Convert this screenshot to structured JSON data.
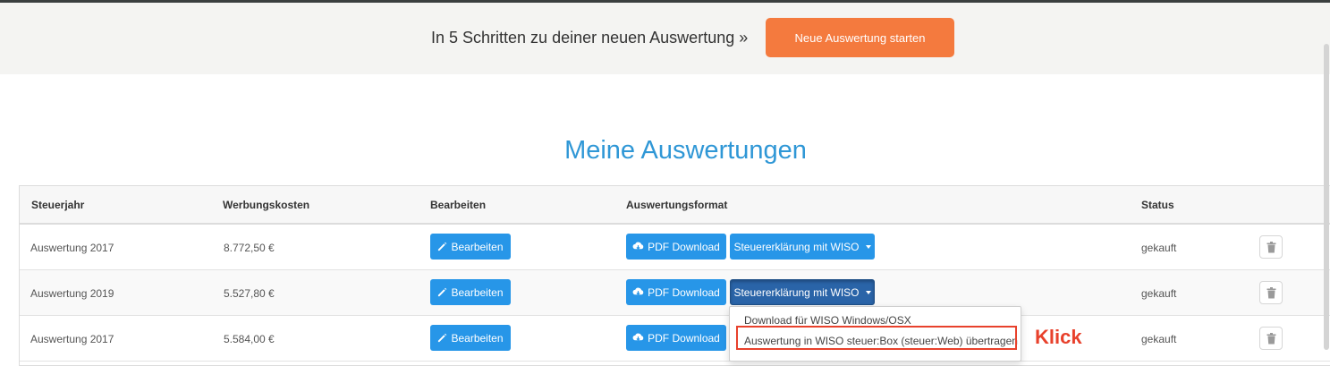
{
  "banner": {
    "text": "In 5 Schritten zu deiner neuen Auswertung »",
    "cta_label": "Neue Auswertung starten"
  },
  "page_title": "Meine Auswertungen",
  "table": {
    "headers": [
      "Steuerjahr",
      "Werbungskosten",
      "Bearbeiten",
      "Auswertungsformat",
      "Status"
    ],
    "rows": [
      {
        "year": "Auswertung 2017",
        "costs": "8.772,50 €",
        "edit_label": "Bearbeiten",
        "pdf_label": "PDF Download",
        "wiso_label": "Steuererklärung mit WISO",
        "status": "gekauft"
      },
      {
        "year": "Auswertung 2019",
        "costs": "5.527,80 €",
        "edit_label": "Bearbeiten",
        "pdf_label": "PDF Download",
        "wiso_label": "Steuererklärung mit WISO",
        "status": "gekauft"
      },
      {
        "year": "Auswertung 2017",
        "costs": "5.584,00 €",
        "edit_label": "Bearbeiten",
        "pdf_label": "PDF Download",
        "wiso_label": "Steuererklärung mit WISO",
        "status": "gekauft"
      }
    ]
  },
  "dropdown": {
    "items": [
      "Download für WISO Windows/OSX",
      "Auswertung in WISO steuer:Box (steuer:Web) übertragen"
    ]
  },
  "annotation": {
    "label": "Klick",
    "color": "#e8412c"
  },
  "colors": {
    "accent_orange": "#f47a3e",
    "primary_blue": "#2796e8",
    "active_blue": "#2a64a8",
    "title_blue": "#2f97d6"
  },
  "icons": {
    "edit": "pencil-icon",
    "pdf": "cloud-download-icon",
    "delete": "trash-icon",
    "dropdown": "caret-down-icon"
  }
}
